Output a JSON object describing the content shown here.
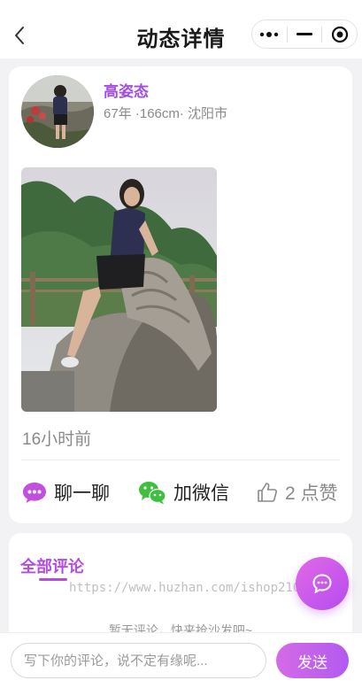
{
  "header": {
    "title": "动态详情",
    "back_icon": "chevron-left-icon",
    "capsule": {
      "more_icon": "more-dots-icon",
      "minimize_icon": "minimize-icon",
      "close_icon": "target-circle-icon"
    }
  },
  "post": {
    "user": {
      "name": "高姿态",
      "info": "67年 ·166cm· 沈阳市"
    },
    "time": "16小时前",
    "actions": {
      "chat_label": "聊一聊",
      "wechat_label": "加微信",
      "like_label": "2 点赞"
    }
  },
  "comments": {
    "title": "全部评论",
    "empty_text": "暂无评论，快来抢沙发吧~"
  },
  "watermark": "https://www.huzhan.com/ishop21025",
  "bottom_bar": {
    "input_placeholder": "写下你的评论，说不定有缘呢...",
    "send_label": "发送"
  },
  "colors": {
    "accent": "#a24de0",
    "wechat": "#3fbf3f",
    "background": "#f2f2f4"
  }
}
